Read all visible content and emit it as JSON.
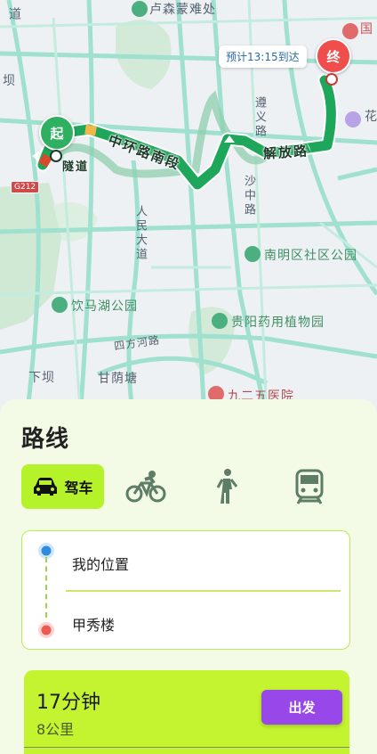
{
  "map": {
    "eta_label": "预计13:15到达",
    "start_pin": "起",
    "end_pin": "终",
    "road_labels": {
      "zhonghuan": "中环路南段",
      "jiefang": "解放路",
      "suidao": "隧道"
    },
    "place_labels": {
      "top_poi": "卢森蒙难处",
      "nanming": "南明区社区公园",
      "yinmahu": "饮马湖公园",
      "yaoyong": "贵阳药用植物园",
      "xiaba": "下坝",
      "ganyintang": "甘荫塘",
      "hospital": "九二五医院",
      "ba": "坝",
      "renmin": "人民大道",
      "zunyi": "遵义路",
      "shazhong": "沙中路",
      "sifang": "四方河路",
      "hua": "花",
      "dao": "道",
      "hospital_right": "国",
      "highway": "G212"
    },
    "colors": {
      "route": "#1ea65a",
      "route_traffic_slow": "#f0b84a",
      "route_traffic_jam": "#d84a2a",
      "alt_route": "#6ec79b"
    }
  },
  "panel": {
    "title": "路线",
    "modes": [
      {
        "icon": "car-icon",
        "label": "驾车",
        "active": true
      },
      {
        "icon": "bicycle-icon",
        "label": "",
        "active": false
      },
      {
        "icon": "walk-icon",
        "label": "",
        "active": false
      },
      {
        "icon": "train-icon",
        "label": "",
        "active": false
      }
    ],
    "origin": "我的位置",
    "destination": "甲秀楼",
    "result": {
      "duration": "17分钟",
      "distance": "8公里",
      "go_button": "出发"
    },
    "colors": {
      "accent": "#b6f22a",
      "go_button": "#9848e8",
      "panel_bg": "#f3fae6"
    }
  }
}
